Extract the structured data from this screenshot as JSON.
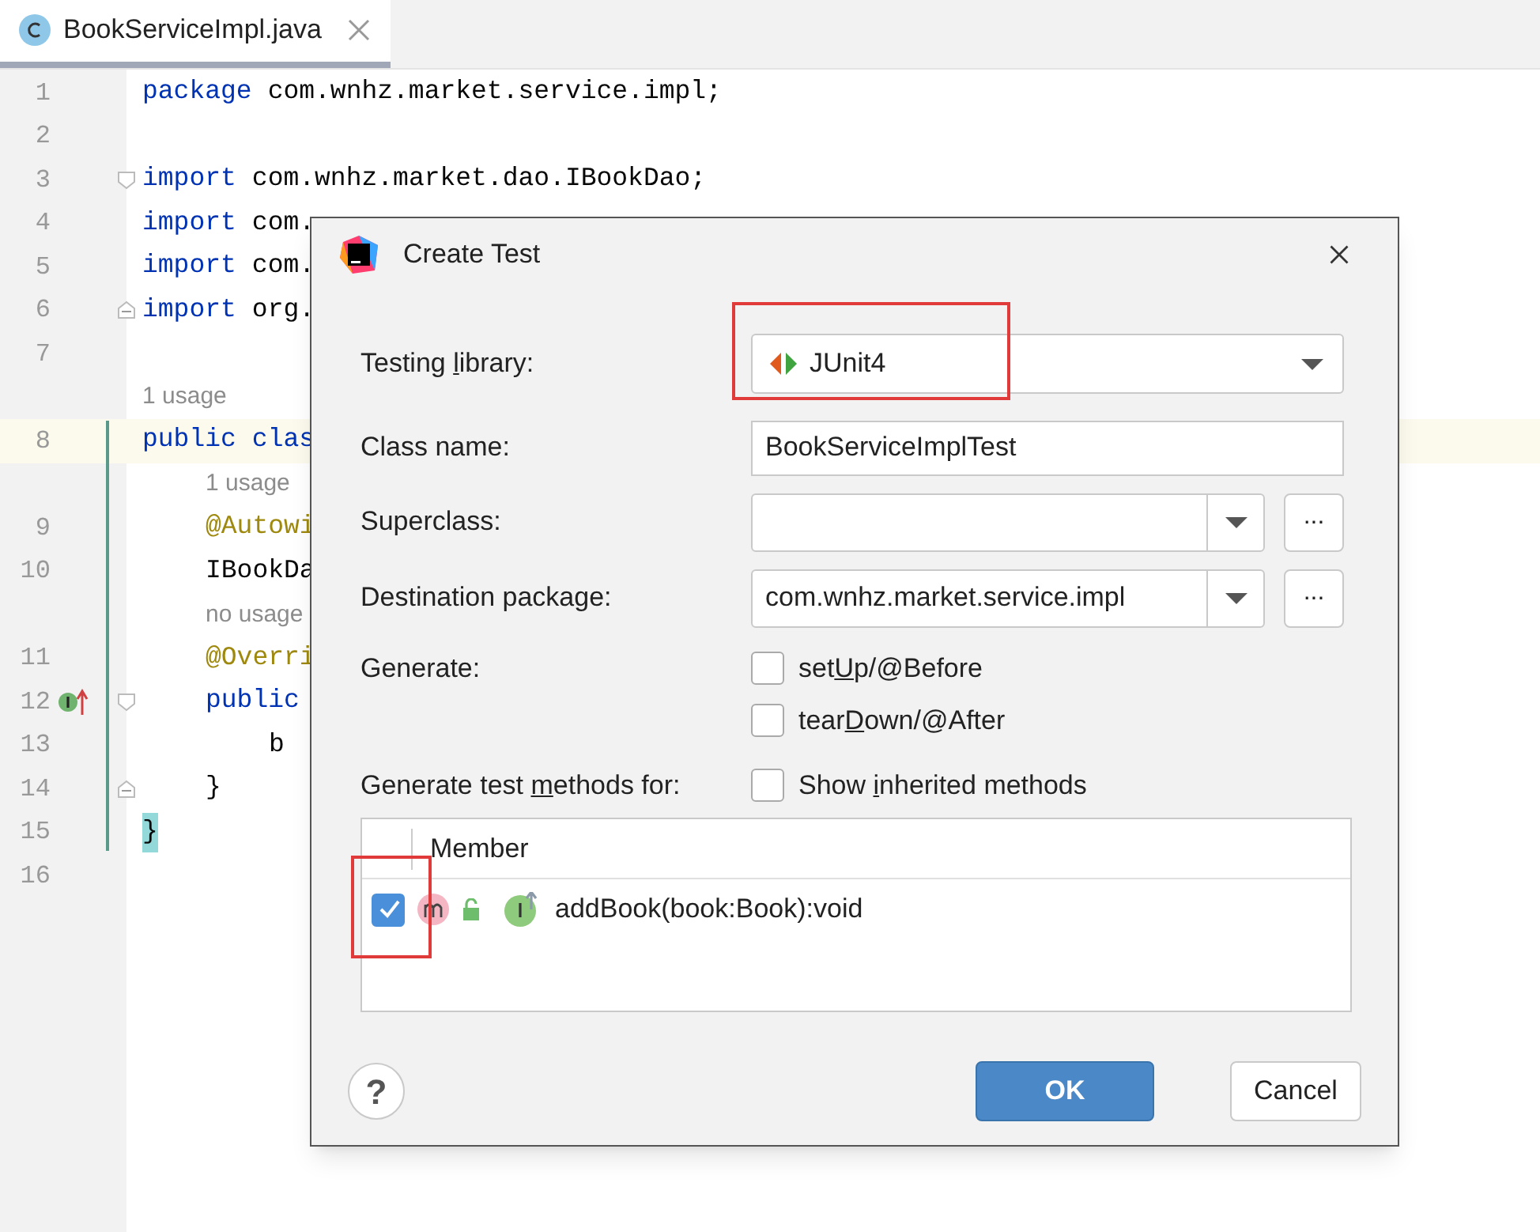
{
  "editor_tab": {
    "label": "BookServiceImpl.java",
    "selected": true
  },
  "lines": [
    {
      "kind": "code",
      "number": "1",
      "current": false,
      "tokens": [
        {
          "kind": "keyword",
          "text": "package"
        },
        {
          "kind": "plain",
          "text": "com.wnhz.market.service.impl;"
        }
      ]
    },
    {
      "kind": "code",
      "number": "2",
      "current": false
    },
    {
      "kind": "code",
      "number": "3",
      "current": false,
      "gutter_icons": [
        {
          "kind": "fold_start"
        }
      ],
      "tokens": [
        {
          "kind": "keyword",
          "text": "import"
        },
        {
          "kind": "plain",
          "text": "com.wnhz.market.dao.IBookDao;"
        }
      ]
    },
    {
      "kind": "code",
      "number": "4",
      "current": false,
      "tokens": [
        {
          "kind": "keyword",
          "text": "import"
        },
        {
          "kind": "plain",
          "text": "com."
        }
      ]
    },
    {
      "kind": "code",
      "number": "5",
      "current": false,
      "tokens": [
        {
          "kind": "keyword",
          "text": "import"
        },
        {
          "kind": "plain",
          "text": "com."
        }
      ]
    },
    {
      "kind": "code",
      "number": "6",
      "current": false,
      "gutter_icons": [
        {
          "kind": "fold_end"
        }
      ],
      "tokens": [
        {
          "kind": "keyword",
          "text": "import"
        },
        {
          "kind": "plain",
          "text": "org."
        }
      ]
    },
    {
      "kind": "code",
      "number": "7",
      "current": false
    },
    {
      "kind": "hint",
      "text": "1 usage"
    },
    {
      "kind": "code",
      "number": "8",
      "current": true,
      "tokens": [
        {
          "kind": "keyword",
          "text": "public"
        },
        {
          "kind": "keyword",
          "text": "clas"
        }
      ],
      "children": [
        {
          "kind": "hint",
          "text": "1 usage"
        },
        {
          "kind": "code",
          "number": "9",
          "current": false,
          "tokens": [
            {
              "kind": "annotation",
              "text": "@Autowi"
            }
          ]
        },
        {
          "kind": "code",
          "number": "10",
          "current": false,
          "tokens": [
            {
              "kind": "plain",
              "text": "IBookDa"
            }
          ]
        },
        {
          "kind": "hint",
          "text": "no usage"
        },
        {
          "kind": "code",
          "number": "11",
          "current": false,
          "tokens": [
            {
              "kind": "annotation",
              "text": "@Overri"
            }
          ]
        },
        {
          "kind": "code",
          "number": "12",
          "current": false,
          "gutter_icons": [
            {
              "kind": "implements"
            },
            {
              "kind": "fold_start"
            }
          ],
          "tokens": [
            {
              "kind": "keyword",
              "text": "public"
            }
          ],
          "children": [
            {
              "kind": "code",
              "number": "13",
              "current": false,
              "tokens": [
                {
                  "kind": "plain",
                  "text": "b"
                }
              ]
            }
          ]
        },
        {
          "kind": "code",
          "number": "14",
          "current": false,
          "gutter_icons": [
            {
              "kind": "fold_end"
            }
          ],
          "tokens": [
            {
              "kind": "plain",
              "text": "}"
            }
          ]
        }
      ]
    },
    {
      "kind": "code",
      "number": "15",
      "current": false,
      "tokens": [
        {
          "kind": "matched_brace",
          "text": "}"
        }
      ]
    },
    {
      "kind": "code",
      "number": "16",
      "current": false
    }
  ],
  "dialog": {
    "title": "Create Test",
    "testing_library": {
      "label_parts": [
        "Testing ",
        "l",
        "ibrary:"
      ],
      "value": "JUnit4"
    },
    "class_name": {
      "label": "Class name:",
      "value": "BookServiceImplTest"
    },
    "superclass": {
      "label": "Superclass:",
      "browse": "..."
    },
    "destination_package": {
      "label": "Destination package:",
      "value": "com.wnhz.market.service.impl",
      "browse": "..."
    },
    "generate": {
      "label": "Generate:",
      "options": [
        {
          "label_parts": [
            "set",
            "U",
            "p/@Before"
          ],
          "checked": false
        },
        {
          "label_parts": [
            "tear",
            "D",
            "own/@After"
          ],
          "checked": false
        }
      ]
    },
    "methods": {
      "label_parts": [
        "Generate test ",
        "m",
        "ethods for:"
      ],
      "show_inherited": {
        "label_parts": [
          "Show ",
          "i",
          "nherited methods"
        ],
        "checked": false
      }
    },
    "table": {
      "columns": [
        "Member"
      ],
      "rows": [
        {
          "member": "addBook(book:Book):void",
          "checked": true
        }
      ]
    },
    "help": "?",
    "buttons": [
      {
        "kind": "primary",
        "label": "OK"
      },
      {
        "kind": "secondary",
        "label": "Cancel"
      }
    ]
  }
}
